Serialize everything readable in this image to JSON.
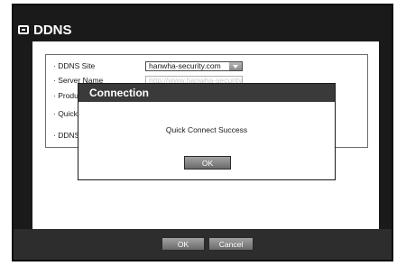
{
  "window": {
    "title": "DDNS"
  },
  "settings": {
    "ddns_site_label": "· DDNS Site",
    "ddns_site_value": "hanwha-security.com",
    "server_name_label": "· Server Name",
    "server_name_value": "http://www.hanwha-security.com",
    "product_label": "· Product",
    "quick_label": "· Quick",
    "ddns_label": "· DDNS"
  },
  "dialog": {
    "title": "Connection",
    "message": "Quick Connect Success",
    "ok_label": "OK"
  },
  "footer": {
    "ok_label": "OK",
    "cancel_label": "Cancel"
  }
}
